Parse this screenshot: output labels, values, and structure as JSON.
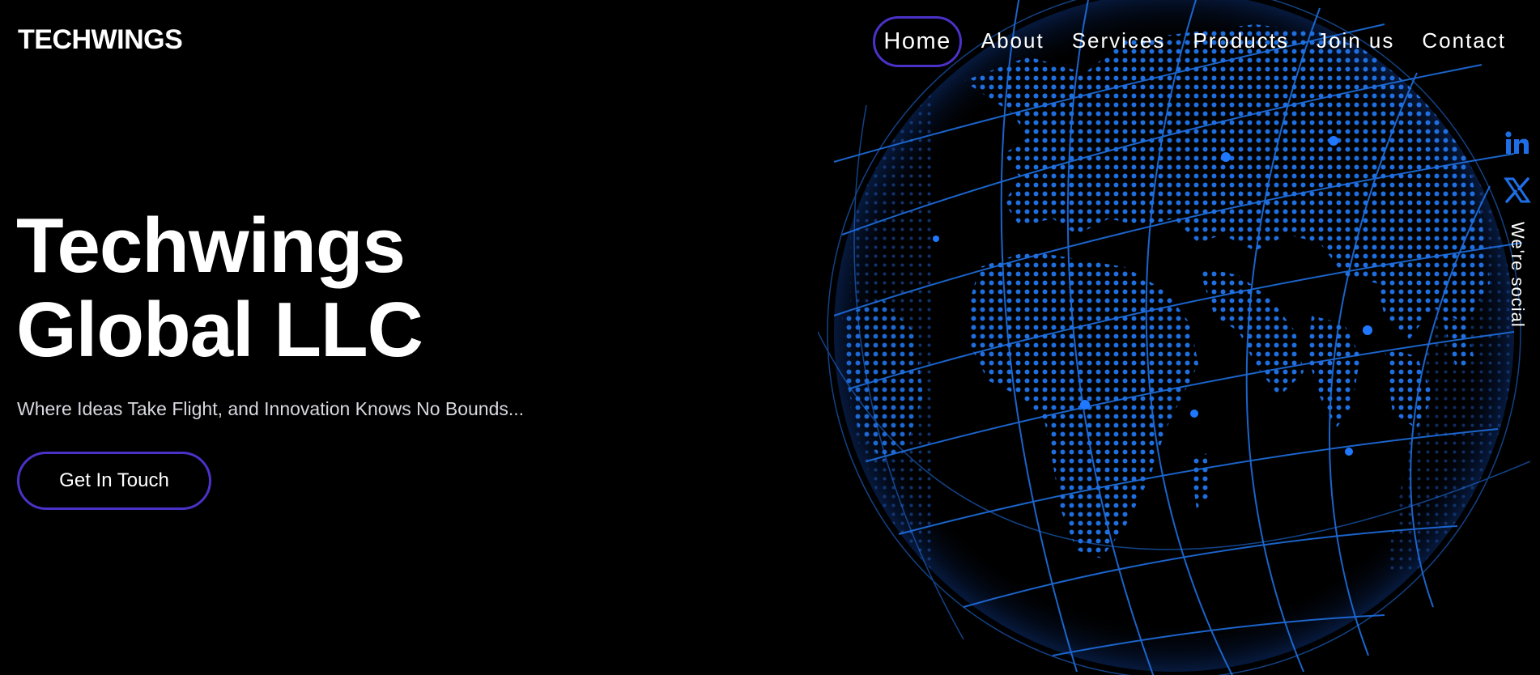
{
  "brand": {
    "logo": "TECHWINGS"
  },
  "nav": {
    "items": [
      {
        "label": "Home"
      },
      {
        "label": "About"
      },
      {
        "label": "Services"
      },
      {
        "label": "Products"
      },
      {
        "label": "Join us"
      },
      {
        "label": "Contact"
      }
    ],
    "active": "Home",
    "active_border_color": "#4a32c8"
  },
  "hero": {
    "title_line1": "Techwings",
    "title_line2": "Global LLC",
    "tagline": "Where Ideas Take Flight, and Innovation Knows No Bounds...",
    "cta_label": "Get In Touch"
  },
  "social": {
    "label": "We're social",
    "icons": [
      "linkedin-icon",
      "x-twitter-icon"
    ],
    "icon_color": "#1e6fe6"
  },
  "colors": {
    "background": "#000000",
    "accent": "#4a32c8",
    "globe": "#1f6fe0"
  }
}
